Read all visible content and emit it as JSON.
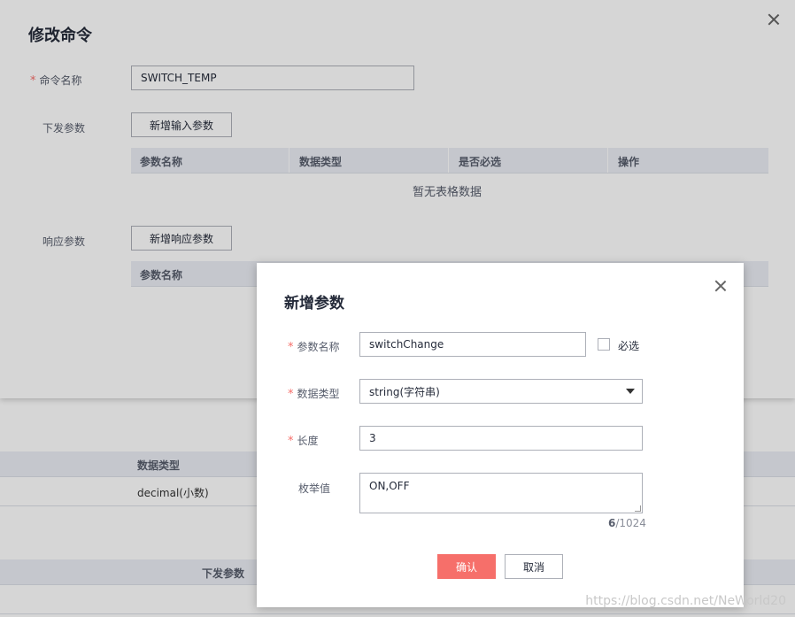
{
  "background": {
    "table1": {
      "header_col": "数据类型",
      "row_value": "decimal(小数)"
    },
    "table2": {
      "header_col": "下发参数"
    }
  },
  "edit_dialog": {
    "title": "修改命令",
    "command_name_label": "命令名称",
    "command_name_value": "SWITCH_TEMP",
    "send_params_label": "下发参数",
    "add_input_param_button": "新增输入参数",
    "table_headers": [
      "参数名称",
      "数据类型",
      "是否必选",
      "操作"
    ],
    "empty_text": "暂无表格数据",
    "response_params_label": "响应参数",
    "add_response_param_button": "新增响应参数",
    "response_table_header_first": "参数名称"
  },
  "add_dialog": {
    "title": "新增参数",
    "param_name_label": "参数名称",
    "param_name_value": "switchChange",
    "required_checkbox_label": "必选",
    "data_type_label": "数据类型",
    "data_type_value": "string(字符串)",
    "length_label": "长度",
    "length_value": "3",
    "enum_label": "枚举值",
    "enum_value": "ON,OFF",
    "counter_current": "6",
    "counter_max": "/1024",
    "confirm_button": "确认",
    "cancel_button": "取消"
  },
  "watermark": "https://blog.csdn.net/NeWorld20",
  "colors": {
    "primary": "#f66f6a",
    "table_header_bg": "#ebeef5"
  }
}
